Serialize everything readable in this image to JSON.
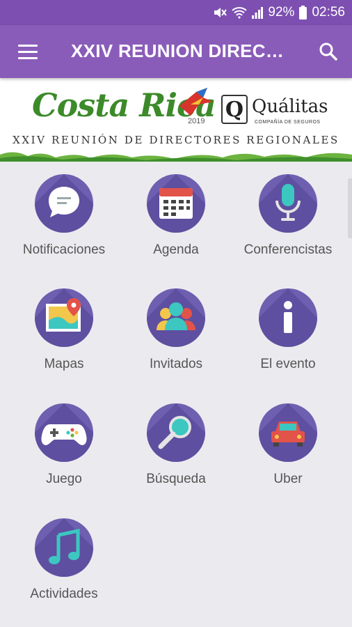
{
  "status_bar": {
    "battery": "92%",
    "time": "02:56",
    "icons": [
      "mute-icon",
      "wifi-icon",
      "signal-icon",
      "battery-icon"
    ]
  },
  "app_bar": {
    "title": "XXIV REUNION DIRECTORES REGIONALES",
    "menu_icon": "hamburger-menu-icon",
    "search_icon": "search-icon"
  },
  "banner": {
    "brand": "Costa Rica",
    "year": "2019",
    "partner_logo": "Q",
    "partner_name": "Quálitas",
    "partner_tagline": "COMPAÑÍA DE SEGUROS",
    "subtitle": "XXIV REUNIÓN DE DIRECTORES REGIONALES"
  },
  "colors": {
    "status_bar": "#7c4fb0",
    "app_bar": "#8a5cb9",
    "tile_circle": "#6f5fb0",
    "background": "#ebebef"
  },
  "menu": [
    {
      "label": "Notificaciones",
      "icon": "chat-bubble-icon"
    },
    {
      "label": "Agenda",
      "icon": "calendar-icon"
    },
    {
      "label": "Conferencistas",
      "icon": "microphone-icon"
    },
    {
      "label": "Mapas",
      "icon": "map-pin-icon"
    },
    {
      "label": "Invitados",
      "icon": "people-icon"
    },
    {
      "label": "El evento",
      "icon": "info-icon"
    },
    {
      "label": "Juego",
      "icon": "gamepad-icon"
    },
    {
      "label": "Búsqueda",
      "icon": "magnifier-icon"
    },
    {
      "label": "Uber",
      "icon": "car-icon"
    },
    {
      "label": "Actividades",
      "icon": "music-note-icon"
    }
  ]
}
